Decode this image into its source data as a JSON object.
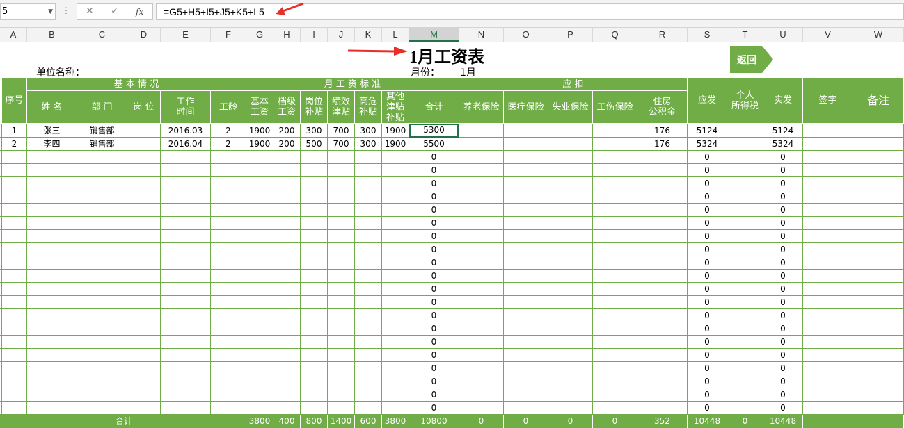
{
  "formula_bar": {
    "name_box": "5",
    "formula": "=G5+H5+I5+J5+K5+L5",
    "cancel_glyph": "✕",
    "enter_glyph": "✓",
    "fx_glyph": "fx"
  },
  "columns": [
    "A",
    "B",
    "C",
    "D",
    "E",
    "F",
    "G",
    "H",
    "I",
    "J",
    "K",
    "L",
    "M",
    "N",
    "O",
    "P",
    "Q",
    "R",
    "S",
    "T",
    "U",
    "V",
    "W"
  ],
  "selected_column": "M",
  "sheet": {
    "title": "1月工资表",
    "unit_label": "单位名称：",
    "month_label": "月份：",
    "month_value": "1月",
    "back_button": "返回",
    "groups": {
      "basic": "基 本 情 况",
      "wage_std": "月 工 资 标 准",
      "deduct": "应   扣"
    },
    "headers": {
      "seq": "序号",
      "name": "姓 名",
      "dept": "部 门",
      "post": "岗 位",
      "work_time": "工作\n时间",
      "seniority": "工龄",
      "base": "基本\n工资",
      "grade": "档级\n工资",
      "post_allow": "岗位\n补贴",
      "perf": "绩效\n津贴",
      "hazard": "高危\n补贴",
      "other": "其他\n津贴\n补贴",
      "total": "合计",
      "pension": "养老保险",
      "medical": "医疗保险",
      "unemploy": "失业保险",
      "injury": "工伤保险",
      "housing": "住房\n公积金",
      "payable": "应发",
      "tax": "个人\n所得税",
      "actual": "实发",
      "sign": "签字",
      "remark": "备注"
    },
    "rows": [
      {
        "seq": "1",
        "name": "张三",
        "dept": "销售部",
        "work_time": "2016.03",
        "seniority": "2",
        "base": "1900",
        "grade": "200",
        "post_allow": "300",
        "perf": "700",
        "hazard": "300",
        "other": "1900",
        "total": "5300",
        "housing": "176",
        "payable": "5124",
        "actual": "5124"
      },
      {
        "seq": "2",
        "name": "李四",
        "dept": "销售部",
        "work_time": "2016.04",
        "seniority": "2",
        "base": "1900",
        "grade": "200",
        "post_allow": "500",
        "perf": "700",
        "hazard": "300",
        "other": "1900",
        "total": "5500",
        "housing": "176",
        "payable": "5324",
        "actual": "5324"
      }
    ],
    "zero_value": "0",
    "empty_rows": 20,
    "totals": {
      "label": "合计",
      "base": "3800",
      "grade": "400",
      "post_allow": "800",
      "perf": "1400",
      "hazard": "600",
      "other": "3800",
      "total": "10800",
      "pension": "0",
      "medical": "0",
      "unemploy": "0",
      "injury": "0",
      "housing": "352",
      "payable": "10448",
      "tax": "0",
      "actual": "10448"
    }
  },
  "colors": {
    "header_green": "#70ad47",
    "arrow_red": "#e8302a",
    "selection_green": "#217346"
  }
}
